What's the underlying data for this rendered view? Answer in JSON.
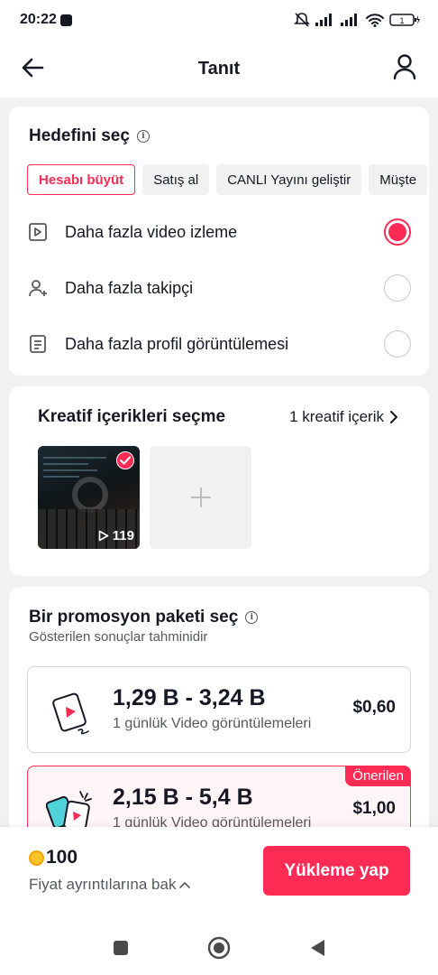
{
  "status_bar": {
    "time": "20:22",
    "battery": "1"
  },
  "header": {
    "title": "Tanıt"
  },
  "goal": {
    "title": "Hedefini seç",
    "chips": [
      {
        "label": "Hesabı büyüt",
        "active": true
      },
      {
        "label": "Satış al",
        "active": false
      },
      {
        "label": "CANLI Yayını geliştir",
        "active": false
      },
      {
        "label": "Müşte",
        "active": false
      }
    ],
    "options": [
      {
        "label": "Daha fazla video izleme",
        "icon": "video-play-icon",
        "selected": true
      },
      {
        "label": "Daha fazla takipçi",
        "icon": "add-user-icon",
        "selected": false
      },
      {
        "label": "Daha fazla profil görüntülemesi",
        "icon": "profile-document-icon",
        "selected": false
      }
    ]
  },
  "creative": {
    "title": "Kreatif içerikleri seçme",
    "link": "1 kreatif içerik",
    "video_views": "119"
  },
  "packages": {
    "title": "Bir promosyon paketi seç",
    "subtitle": "Gösterilen sonuçlar tahminidir",
    "items": [
      {
        "range": "1,29 B - 3,24 B",
        "desc": "1 günlük Video görüntülemeleri",
        "price": "$0,60"
      },
      {
        "range": "2,15 B - 5,4 B",
        "desc": "1 günlük Video görüntülemeleri",
        "price": "$1,00",
        "badge": "Önerilen"
      }
    ]
  },
  "footer": {
    "coins": "100",
    "details_link": "Fiyat ayrıntılarına bak",
    "cta": "Yükleme yap"
  },
  "colors": {
    "accent": "#fe2c55",
    "text": "#161823",
    "muted": "#57585e",
    "background": "#f1f1f2"
  }
}
